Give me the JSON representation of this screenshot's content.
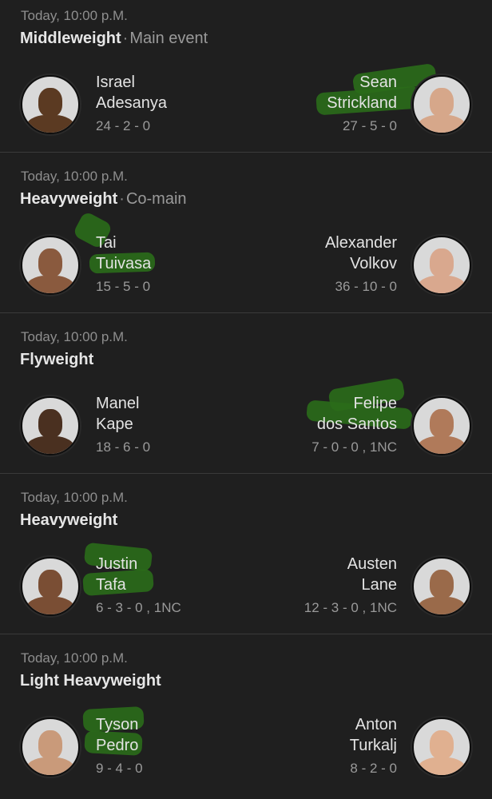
{
  "fights": [
    {
      "time": "Today, 10:00 p.M.",
      "weight_class": "Middleweight",
      "separator": "·",
      "note": "Main event",
      "left": {
        "first": "Israel",
        "last": "Adesanya",
        "record": "24 - 2 - 0",
        "skin": "#5b3a22"
      },
      "right": {
        "first": "Sean",
        "last": "Strickland",
        "record": "27 - 5 - 0",
        "skin": "#d6a78a"
      }
    },
    {
      "time": "Today, 10:00 p.M.",
      "weight_class": "Heavyweight",
      "separator": "·",
      "note": "Co-main",
      "left": {
        "first": "Tai",
        "last": "Tuivasa",
        "record": "15 - 5 - 0",
        "skin": "#8a5a3e"
      },
      "right": {
        "first": "Alexander",
        "last": "Volkov",
        "record": "36 - 10 - 0",
        "skin": "#d9a88e"
      }
    },
    {
      "time": "Today, 10:00 p.M.",
      "weight_class": "Flyweight",
      "separator": "",
      "note": "",
      "left": {
        "first": "Manel",
        "last": "Kape",
        "record": "18 - 6 - 0",
        "skin": "#4a3020"
      },
      "right": {
        "first": "Felipe",
        "last": "dos Santos",
        "record": "7 - 0 - 0 , 1NC",
        "skin": "#b07a5a"
      }
    },
    {
      "time": "Today, 10:00 p.M.",
      "weight_class": "Heavyweight",
      "separator": "",
      "note": "",
      "left": {
        "first": "Justin",
        "last": "Tafa",
        "record": "6 - 3 - 0 , 1NC",
        "skin": "#7a4e34"
      },
      "right": {
        "first": "Austen",
        "last": "Lane",
        "record": "12 - 3 - 0 , 1NC",
        "skin": "#9a6a4a"
      }
    },
    {
      "time": "Today, 10:00 p.M.",
      "weight_class": "Light Heavyweight",
      "separator": "",
      "note": "",
      "left": {
        "first": "Tyson",
        "last": "Pedro",
        "record": "9 - 4 - 0",
        "skin": "#c99a7a"
      },
      "right": {
        "first": "Anton",
        "last": "Turkalj",
        "record": "8 - 2 - 0",
        "skin": "#e0b090"
      }
    }
  ],
  "colors": {
    "background": "#1f1f1f",
    "highlight": "#2a6b1a",
    "avatar_bg": "#d9d9d9"
  },
  "icons": {
    "fighter_photo": "avatar-icon"
  }
}
